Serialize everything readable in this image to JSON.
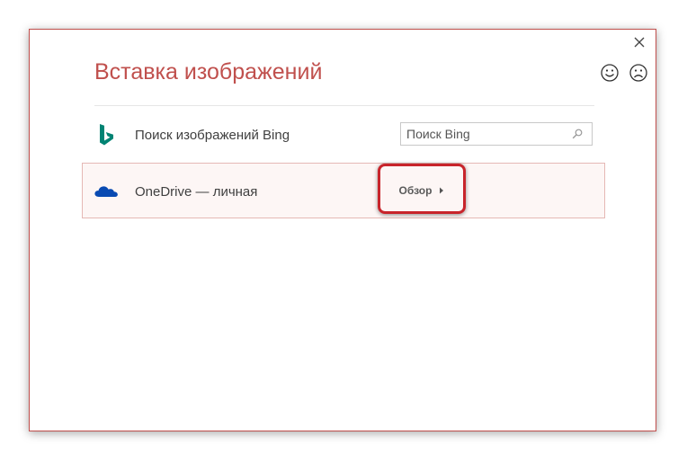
{
  "dialog": {
    "title": "Вставка изображений",
    "close_icon": "close-icon",
    "feedback": {
      "smile_icon": "smiley-face-icon",
      "frown_icon": "frowny-face-icon"
    },
    "accent_color": "#c0504d"
  },
  "sources": {
    "bing": {
      "icon": "bing-logo-icon",
      "label": "Поиск изображений Bing",
      "search": {
        "value": "",
        "placeholder": "Поиск Bing",
        "icon": "search-icon"
      }
    },
    "onedrive": {
      "icon": "onedrive-cloud-icon",
      "label": "OneDrive — личная",
      "browse_label": "Обзор",
      "browse_icon": "caret-right-icon",
      "highlight_color": "#c8242b"
    }
  }
}
